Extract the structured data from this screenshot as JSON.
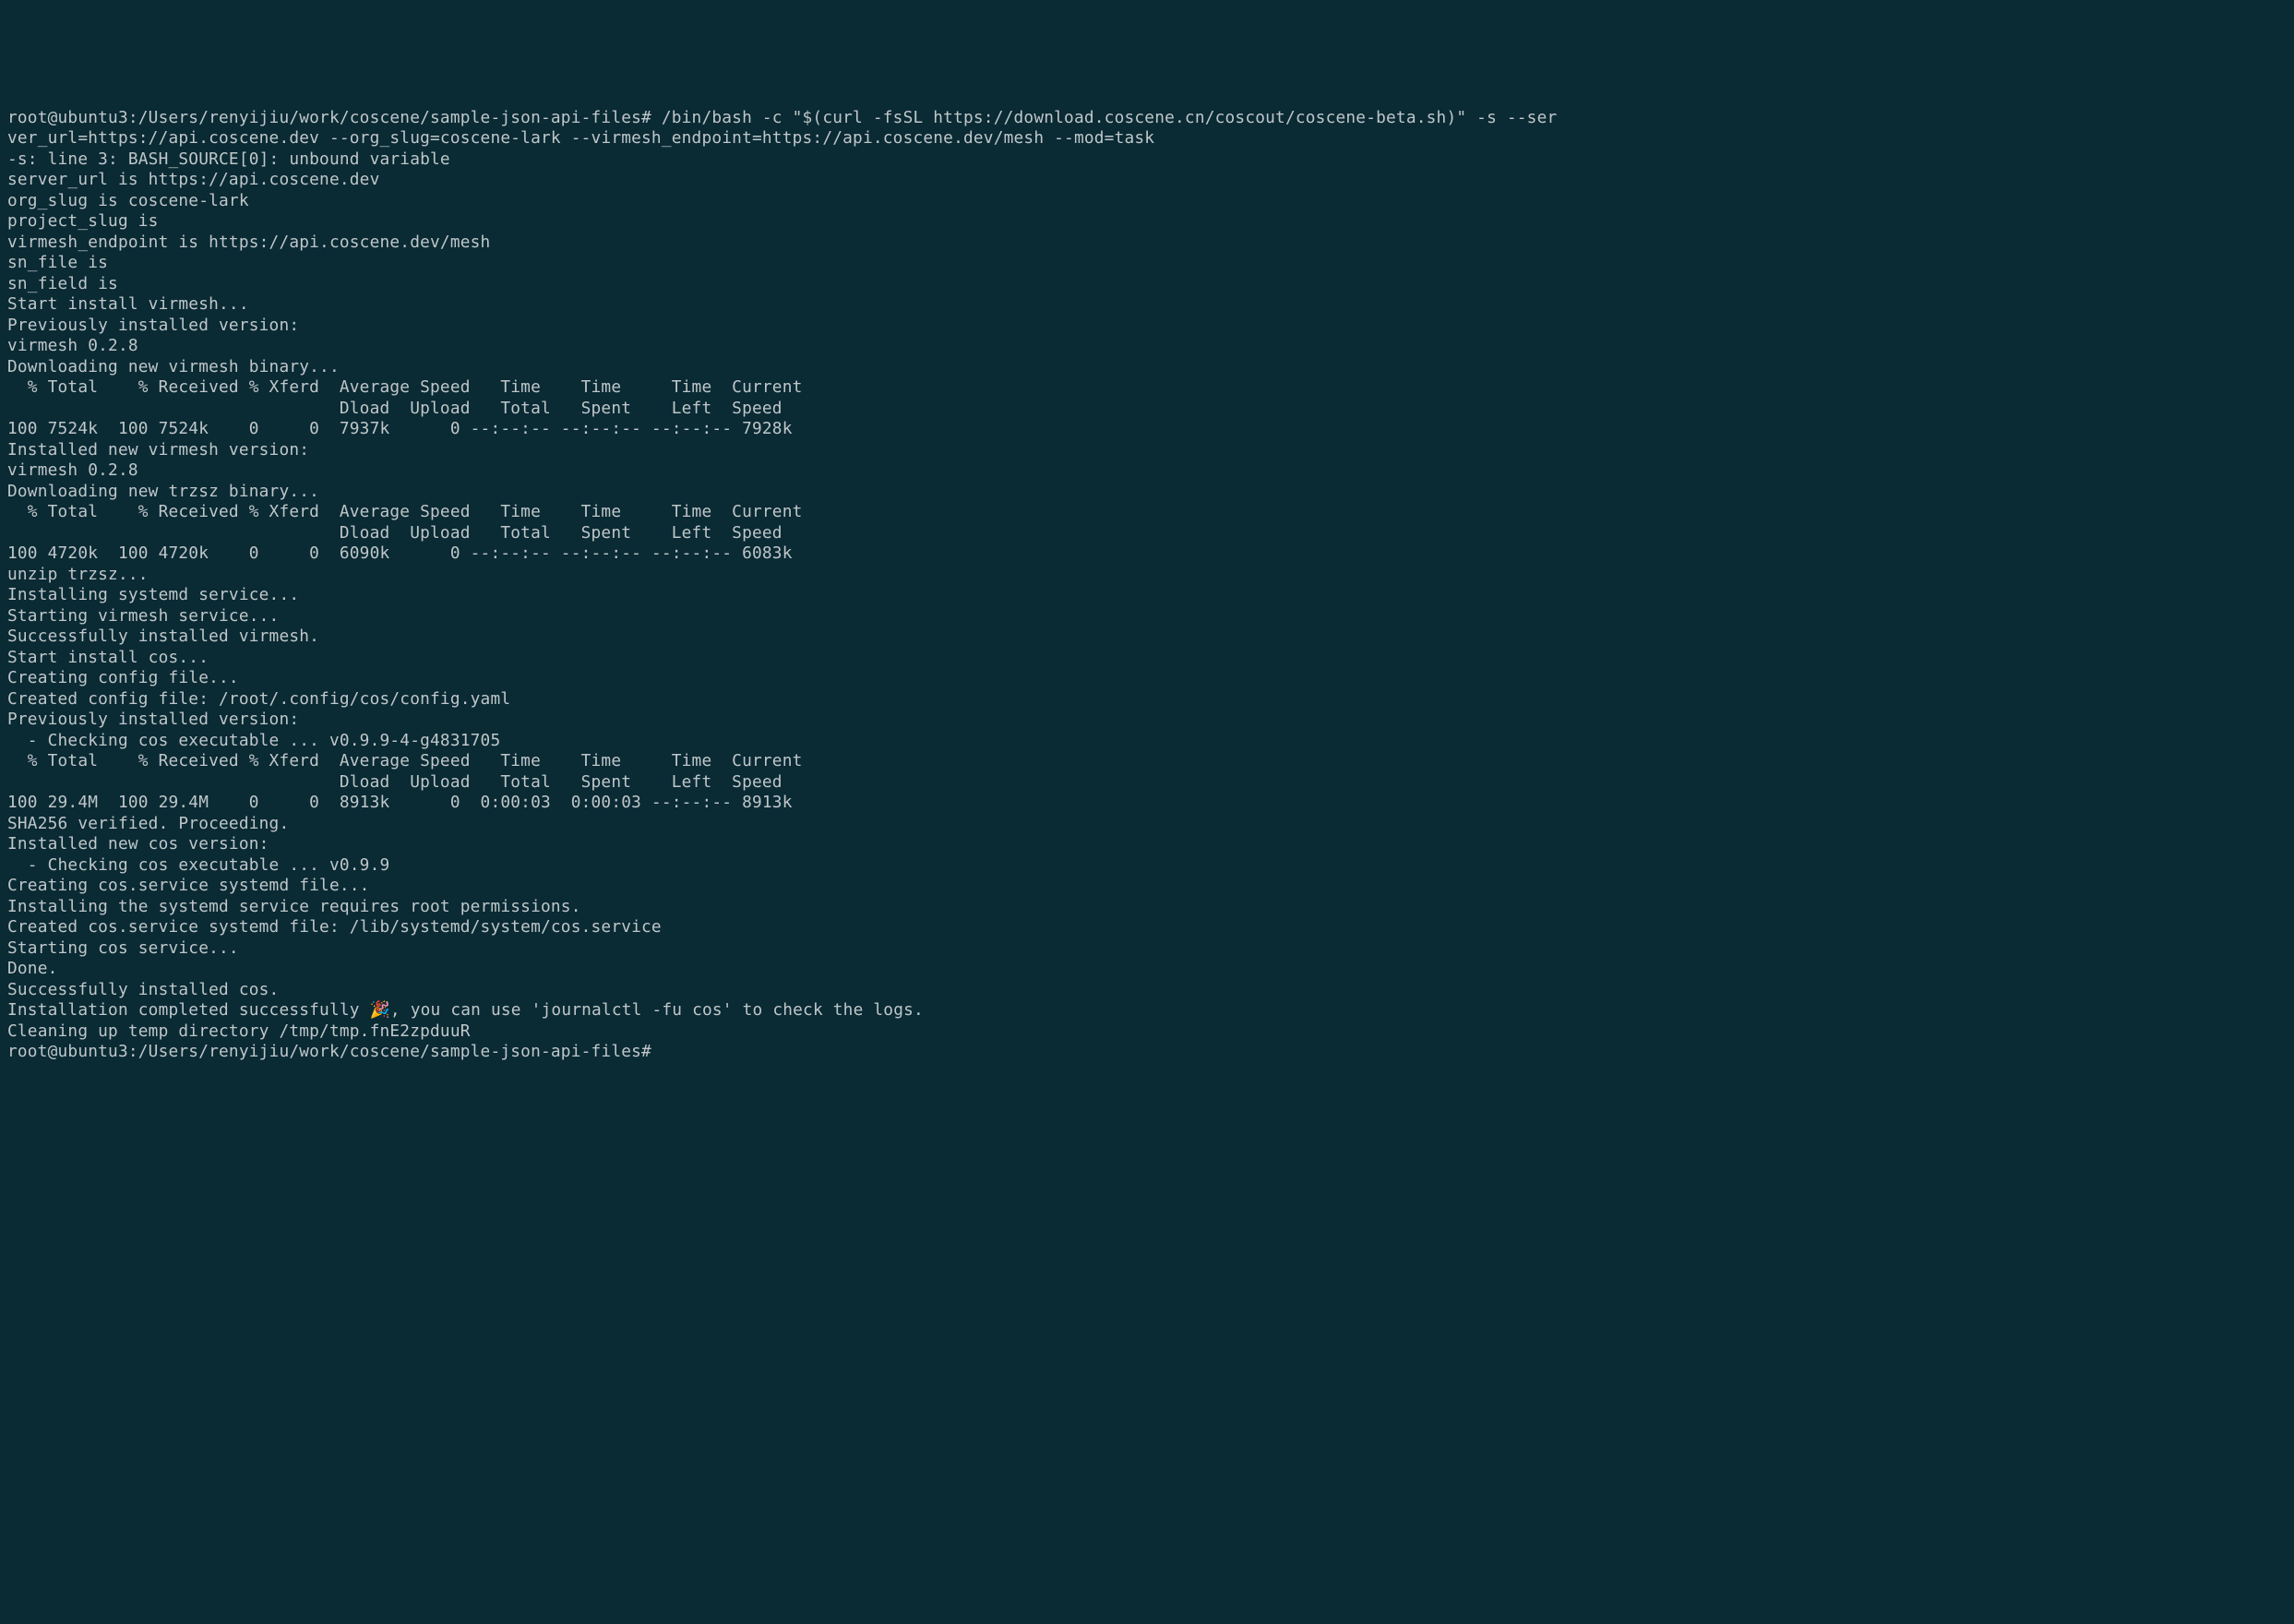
{
  "terminal": {
    "lines": [
      "root@ubuntu3:/Users/renyijiu/work/coscene/sample-json-api-files# /bin/bash -c \"$(curl -fsSL https://download.coscene.cn/coscout/coscene-beta.sh)\" -s --ser",
      "ver_url=https://api.coscene.dev --org_slug=coscene-lark --virmesh_endpoint=https://api.coscene.dev/mesh --mod=task",
      "-s: line 3: BASH_SOURCE[0]: unbound variable",
      "server_url is https://api.coscene.dev",
      "org_slug is coscene-lark",
      "project_slug is",
      "virmesh_endpoint is https://api.coscene.dev/mesh",
      "sn_file is",
      "sn_field is",
      "Start install virmesh...",
      "Previously installed version:",
      "virmesh 0.2.8",
      "Downloading new virmesh binary...",
      "  % Total    % Received % Xferd  Average Speed   Time    Time     Time  Current",
      "                                 Dload  Upload   Total   Spent    Left  Speed",
      "100 7524k  100 7524k    0     0  7937k      0 --:--:-- --:--:-- --:--:-- 7928k",
      "Installed new virmesh version:",
      "virmesh 0.2.8",
      "Downloading new trzsz binary...",
      "  % Total    % Received % Xferd  Average Speed   Time    Time     Time  Current",
      "                                 Dload  Upload   Total   Spent    Left  Speed",
      "100 4720k  100 4720k    0     0  6090k      0 --:--:-- --:--:-- --:--:-- 6083k",
      "unzip trzsz...",
      "Installing systemd service...",
      "Starting virmesh service...",
      "Successfully installed virmesh.",
      "Start install cos...",
      "Creating config file...",
      "Created config file: /root/.config/cos/config.yaml",
      "Previously installed version:",
      "  - Checking cos executable ... v0.9.9-4-g4831705",
      "  % Total    % Received % Xferd  Average Speed   Time    Time     Time  Current",
      "                                 Dload  Upload   Total   Spent    Left  Speed",
      "100 29.4M  100 29.4M    0     0  8913k      0  0:00:03  0:00:03 --:--:-- 8913k",
      "SHA256 verified. Proceeding.",
      "Installed new cos version:",
      "  - Checking cos executable ... v0.9.9",
      "Creating cos.service systemd file...",
      "Installing the systemd service requires root permissions.",
      "Created cos.service systemd file: /lib/systemd/system/cos.service",
      "Starting cos service...",
      "Done.",
      "Successfully installed cos.",
      "Installation completed successfully 🎉, you can use 'journalctl -fu cos' to check the logs.",
      "Cleaning up temp directory /tmp/tmp.fnE2zpduuR",
      "root@ubuntu3:/Users/renyijiu/work/coscene/sample-json-api-files#"
    ]
  }
}
